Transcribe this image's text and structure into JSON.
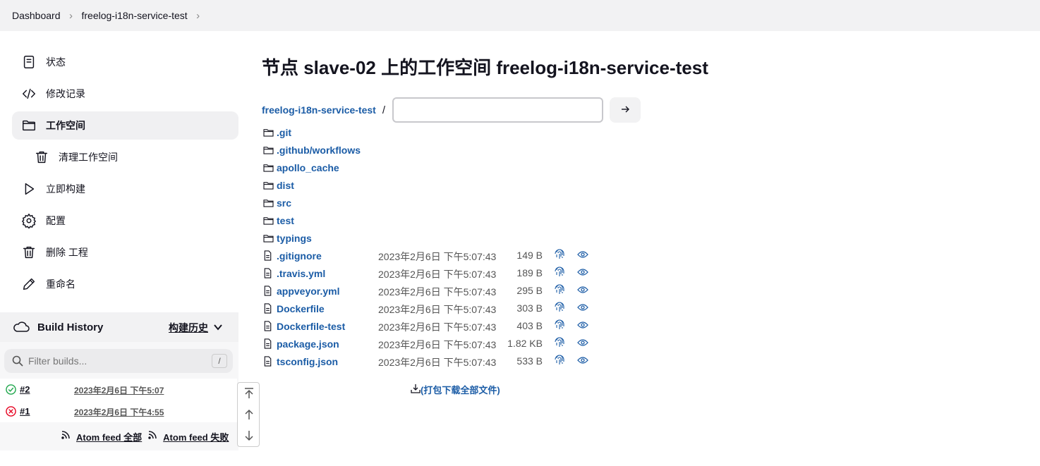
{
  "breadcrumb": {
    "items": [
      "Dashboard",
      "freelog-i18n-service-test"
    ]
  },
  "sidebar": {
    "items": [
      {
        "label": "状态",
        "icon": "document-icon"
      },
      {
        "label": "修改记录",
        "icon": "code-icon"
      },
      {
        "label": "工作空间",
        "icon": "folder-icon",
        "active": true
      },
      {
        "label": "清理工作空间",
        "icon": "trash-icon",
        "sub": true
      },
      {
        "label": "立即构建",
        "icon": "play-icon"
      },
      {
        "label": "配置",
        "icon": "gear-icon"
      },
      {
        "label": "删除 工程",
        "icon": "trash-icon"
      },
      {
        "label": "重命名",
        "icon": "pencil-icon"
      }
    ]
  },
  "build_history": {
    "title": "Build History",
    "trend_label": "构建历史",
    "filter_placeholder": "Filter builds...",
    "filter_shortcut": "/",
    "builds": [
      {
        "number": "#2",
        "time": "2023年2月6日 下午5:07",
        "status": "success",
        "status_color": "#1ea64b"
      },
      {
        "number": "#1",
        "time": "2023年2月6日 下午4:55",
        "status": "failed",
        "status_color": "#e6001f"
      }
    ],
    "feed_all": "Atom feed 全部",
    "feed_failed": "Atom feed 失败"
  },
  "main": {
    "title": "节点 slave-02 上的工作空间 freelog-i18n-service-test",
    "path_root": "freelog-i18n-service-test",
    "path_separator": "/",
    "path_input_value": "",
    "folders": [
      ".git",
      ".github/workflows",
      "apollo_cache",
      "dist",
      "src",
      "test",
      "typings"
    ],
    "files": [
      {
        "name": ".gitignore",
        "date": "2023年2月6日 下午5:07:43",
        "size": "149 B"
      },
      {
        "name": ".travis.yml",
        "date": "2023年2月6日 下午5:07:43",
        "size": "189 B"
      },
      {
        "name": "appveyor.yml",
        "date": "2023年2月6日 下午5:07:43",
        "size": "295 B"
      },
      {
        "name": "Dockerfile",
        "date": "2023年2月6日 下午5:07:43",
        "size": "303 B"
      },
      {
        "name": "Dockerfile-test",
        "date": "2023年2月6日 下午5:07:43",
        "size": "403 B"
      },
      {
        "name": "package.json",
        "date": "2023年2月6日 下午5:07:43",
        "size": "1.82 KB"
      },
      {
        "name": "tsconfig.json",
        "date": "2023年2月6日 下午5:07:43",
        "size": "533 B"
      }
    ],
    "download_label": "(打包下载全部文件)"
  },
  "colors": {
    "link": "#1b5ca6",
    "text": "#14141f",
    "muted": "#555555"
  }
}
